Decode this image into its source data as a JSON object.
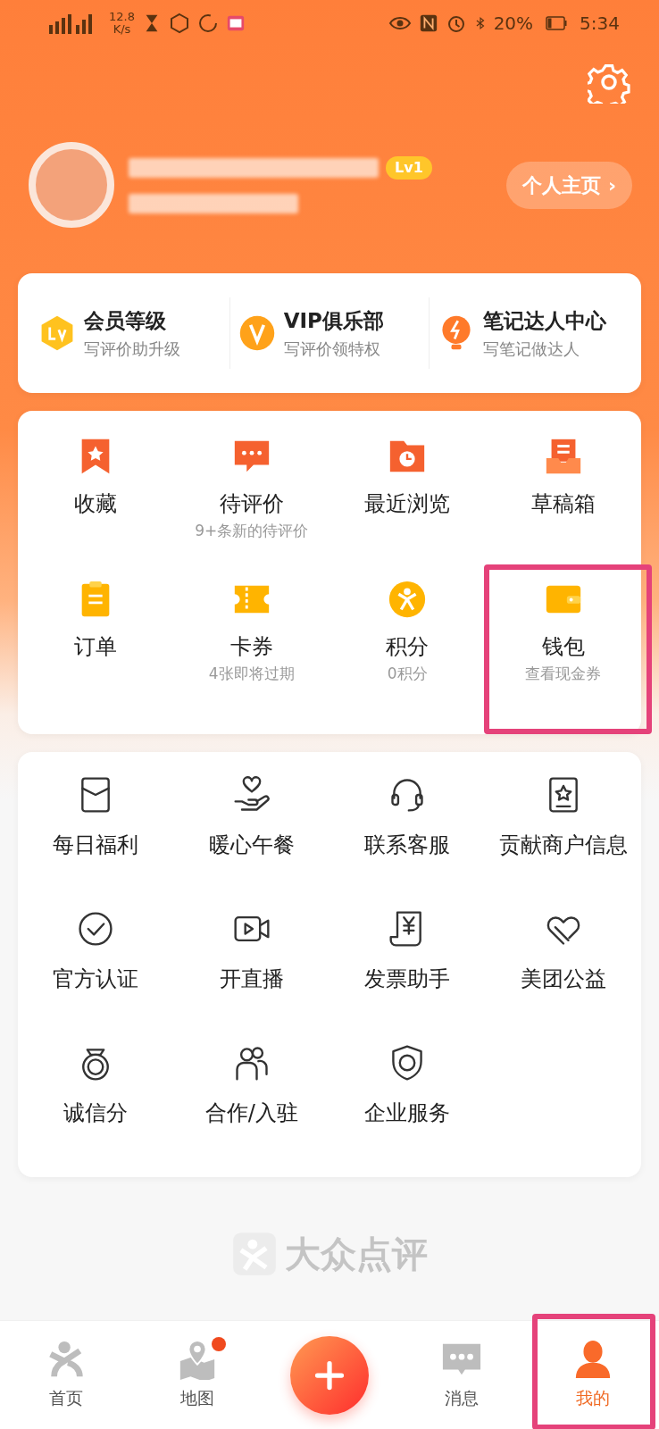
{
  "status_bar": {
    "speed": "12.8",
    "speed_unit": "K/s",
    "battery": "20%",
    "time": "5:34"
  },
  "profile": {
    "level_badge": "Lv1",
    "homepage_button": "个人主页 ›"
  },
  "member_links": [
    {
      "title": "会员等级",
      "subtitle": "写评价助升级"
    },
    {
      "title": "VIP俱乐部",
      "subtitle": "写评价领特权"
    },
    {
      "title": "笔记达人中心",
      "subtitle": "写笔记做达人"
    }
  ],
  "main_grid": [
    {
      "label": "收藏",
      "highlighted": false
    },
    {
      "label": "待评价",
      "subtitle": "9+条新的待评价",
      "highlighted": false
    },
    {
      "label": "最近浏览",
      "highlighted": false
    },
    {
      "label": "草稿箱",
      "highlighted": false
    },
    {
      "label": "订单",
      "highlighted": false
    },
    {
      "label": "卡券",
      "subtitle": "4张即将过期",
      "highlighted": false
    },
    {
      "label": "积分",
      "subtitle": "0积分",
      "highlighted": false
    },
    {
      "label": "钱包",
      "subtitle": "查看现金券",
      "highlighted": true
    }
  ],
  "services": [
    {
      "label": "每日福利"
    },
    {
      "label": "暖心午餐"
    },
    {
      "label": "联系客服"
    },
    {
      "label": "贡献商户信息"
    },
    {
      "label": "官方认证"
    },
    {
      "label": "开直播"
    },
    {
      "label": "发票助手"
    },
    {
      "label": "美团公益"
    },
    {
      "label": "诚信分"
    },
    {
      "label": "合作/入驻"
    },
    {
      "label": "企业服务"
    }
  ],
  "footer_brand": "大众点评",
  "tabs": [
    {
      "label": "首页",
      "selected": false,
      "badge": false,
      "highlighted": false
    },
    {
      "label": "地图",
      "selected": false,
      "badge": true,
      "highlighted": false
    },
    {
      "kind": "add"
    },
    {
      "label": "消息",
      "selected": false,
      "badge": false,
      "highlighted": false
    },
    {
      "label": "我的",
      "selected": true,
      "badge": false,
      "highlighted": true
    }
  ]
}
